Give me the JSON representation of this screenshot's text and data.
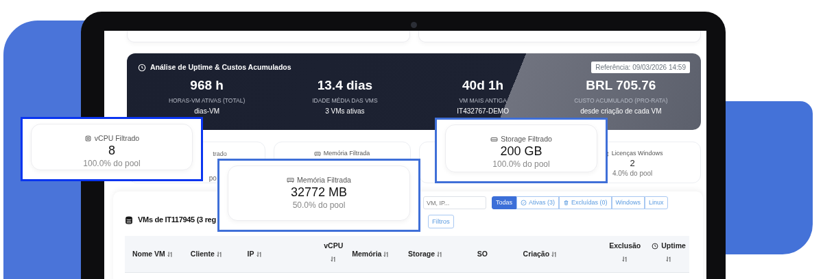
{
  "uptime_panel": {
    "title": "Análise de Uptime & Custos Acumulados",
    "reference": "Referência: 09/03/2026 14:59",
    "stats": [
      {
        "value": "968 h",
        "label": "HORAS-VM ATIVAS (TOTAL)",
        "sub": "dias-VM"
      },
      {
        "value": "13.4 dias",
        "label": "IDADE MÉDIA DAS VMS",
        "sub": "3 VMs ativas"
      },
      {
        "value": "40d 1h",
        "label": "VM MAIS ANTIGA",
        "sub": "IT432767-DEMO"
      },
      {
        "value": "BRL 705.76",
        "label": "CUSTO ACUMULADO (PRO-RATA)",
        "sub": "desde criação de cada VM"
      }
    ]
  },
  "resource_cards": [
    {
      "kind": "fragment",
      "label": "trado",
      "note": "po"
    },
    {
      "kind": "memory",
      "label": "Memória Filtrada"
    },
    {
      "kind": "hidden"
    },
    {
      "kind": "windows",
      "label": "Licenças Windows",
      "value": "2",
      "note": "4.0% do pool"
    }
  ],
  "vm_table": {
    "title": "VMs de IT117945 (3 reg",
    "search": {
      "placeholder": "VM, IP..."
    },
    "filters": [
      {
        "kind": "plain",
        "label": "Todas",
        "selected": true
      },
      {
        "kind": "check",
        "label": "Ativas (3)",
        "selected": false
      },
      {
        "kind": "trash",
        "label": "Excluídas (0)",
        "selected": false
      },
      {
        "kind": "plain",
        "label": "Windows",
        "selected": false
      },
      {
        "kind": "plain",
        "label": "Linux",
        "selected": false
      }
    ],
    "filters_button": "Filtros",
    "columns": [
      {
        "kind": "sort",
        "label": "Nome VM"
      },
      {
        "kind": "sort",
        "label": "Cliente"
      },
      {
        "kind": "sort",
        "label": "IP"
      },
      {
        "kind": "sort-below",
        "label": "vCPU"
      },
      {
        "kind": "sort",
        "label": "Memória"
      },
      {
        "kind": "sort",
        "label": "Storage"
      },
      {
        "kind": "plain",
        "label": "SO"
      },
      {
        "kind": "sort",
        "label": "Criação"
      },
      {
        "kind": "sort-below",
        "label": "Exclusão"
      },
      {
        "kind": "clock",
        "label": "Uptime"
      }
    ]
  },
  "callouts": [
    {
      "kind": "cpu",
      "label": "vCPU Filtrado",
      "value": "8",
      "note": "100.0% do pool"
    },
    {
      "kind": "memory",
      "label": "Memória Filtrada",
      "value": "32772 MB",
      "note": "50.0% do pool"
    },
    {
      "kind": "storage",
      "label": "Storage Filtrado",
      "value": "200 GB",
      "note": "100.0% do pool"
    }
  ]
}
